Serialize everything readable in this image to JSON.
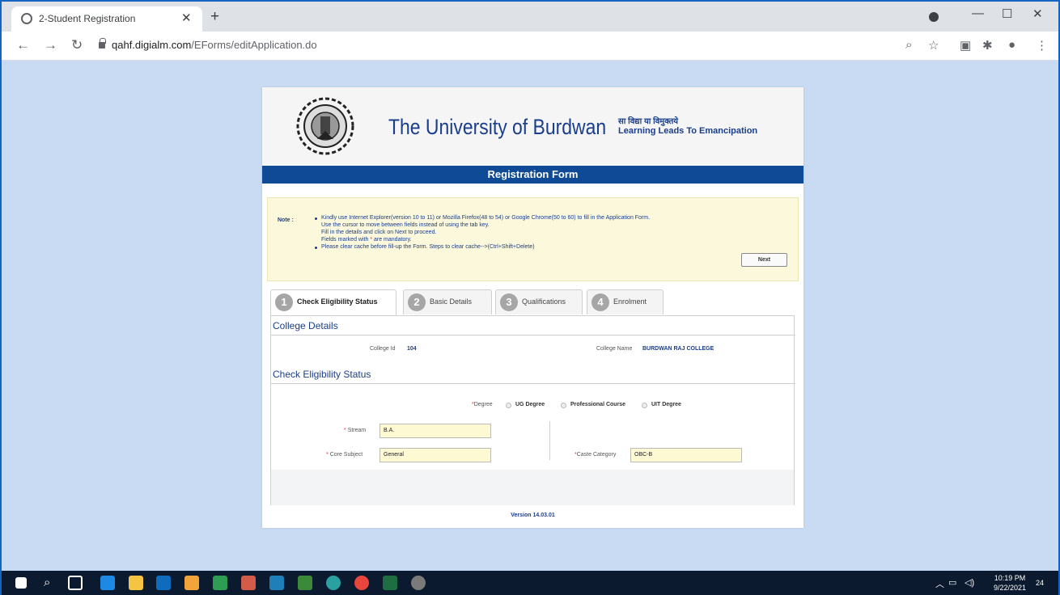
{
  "browser": {
    "tab_title": "2-Student Registration",
    "url_host": "qahf.digialm.com",
    "url_path": "/EForms/editApplication.do"
  },
  "header": {
    "university": "The University of Burdwan",
    "hindi": "सा विद्या या विमुक्तये",
    "motto": "Learning Leads To Emancipation",
    "form_title": "Registration Form"
  },
  "note": {
    "label": "Note :",
    "line1": "Kindly use Internet Explorer(version 10 to 11) or Mozilla Firefox(48 to 54) or Google Chrome(50 to 60) to fill in the Application Form.",
    "line2": "Use the cursor to move between fields instead of using the tab key.",
    "line3": "Fill in the details and click on Next to proceed.",
    "line4_a": "Fields marked with",
    "line4_star": "*",
    "line4_b": "are mandatory.",
    "line5": "Please clear cache before fill-up the Form. Steps to clear cache-->(Ctrl+Shift+Delete)"
  },
  "tabs": [
    {
      "num": "1",
      "label": "Check Eligibility Status"
    },
    {
      "num": "2",
      "label": "Basic Details"
    },
    {
      "num": "3",
      "label": "Qualifications"
    },
    {
      "num": "4",
      "label": "Enrolment"
    }
  ],
  "college": {
    "section_title": "College Details",
    "id_label": "College Id",
    "id_value": "104",
    "name_label": "College Name",
    "name_value": "BURDWAN RAJ COLLEGE"
  },
  "eligibility": {
    "section_title": "Check Eligibility Status",
    "degree_label": "Degree",
    "degree_options": [
      "UG Degree",
      "Professional Course",
      "UIT Degree"
    ],
    "stream_label": "Stream",
    "stream_value": "B.A.",
    "core_label": "Core Subject",
    "core_value": "General",
    "caste_label": "Caste Category",
    "caste_value": "OBC-B",
    "next_label": "Next"
  },
  "version": "Version 14.03.01",
  "taskbar": {
    "time": "10:19 PM",
    "date": "9/22/2021",
    "notif_count": "24"
  }
}
